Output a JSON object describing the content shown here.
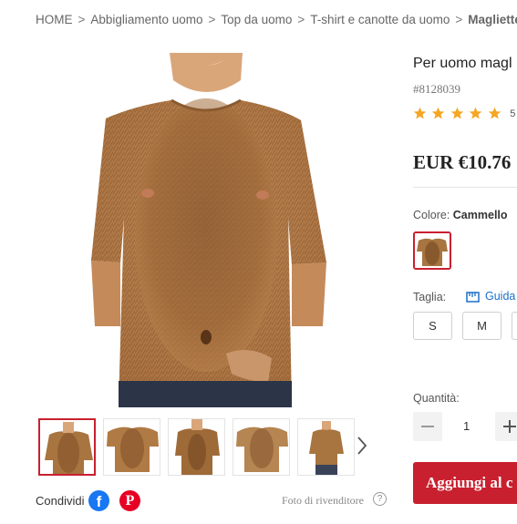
{
  "breadcrumb": {
    "items": [
      "HOME",
      "Abbigliamento uomo",
      "Top da uomo",
      "T-shirt e canotte da uomo"
    ],
    "current": "Magliette grafich",
    "separator": ">"
  },
  "gallery": {
    "thumb_count": 5,
    "next_icon": "chevron-right-icon"
  },
  "share": {
    "label": "Condividi",
    "facebook_glyph": "f",
    "pinterest_glyph": "P",
    "seller_photo": "Foto di rivenditore",
    "help_glyph": "?"
  },
  "product": {
    "title": "Per uomo magl",
    "sku": "#8128039",
    "rating": 5,
    "review_count": "5",
    "price": "EUR €10.76"
  },
  "color": {
    "label": "Colore:",
    "value": "Cammello"
  },
  "size": {
    "label": "Taglia:",
    "guide_label": "Guida",
    "options": [
      "S",
      "M"
    ]
  },
  "quantity": {
    "label": "Quantità:",
    "value": "1"
  },
  "cart": {
    "add_label": "Aggiungi al c"
  },
  "colors": {
    "accent": "#c8202f",
    "star": "#f5a623",
    "link": "#1b6ec9",
    "shirt": "#a8743f"
  }
}
